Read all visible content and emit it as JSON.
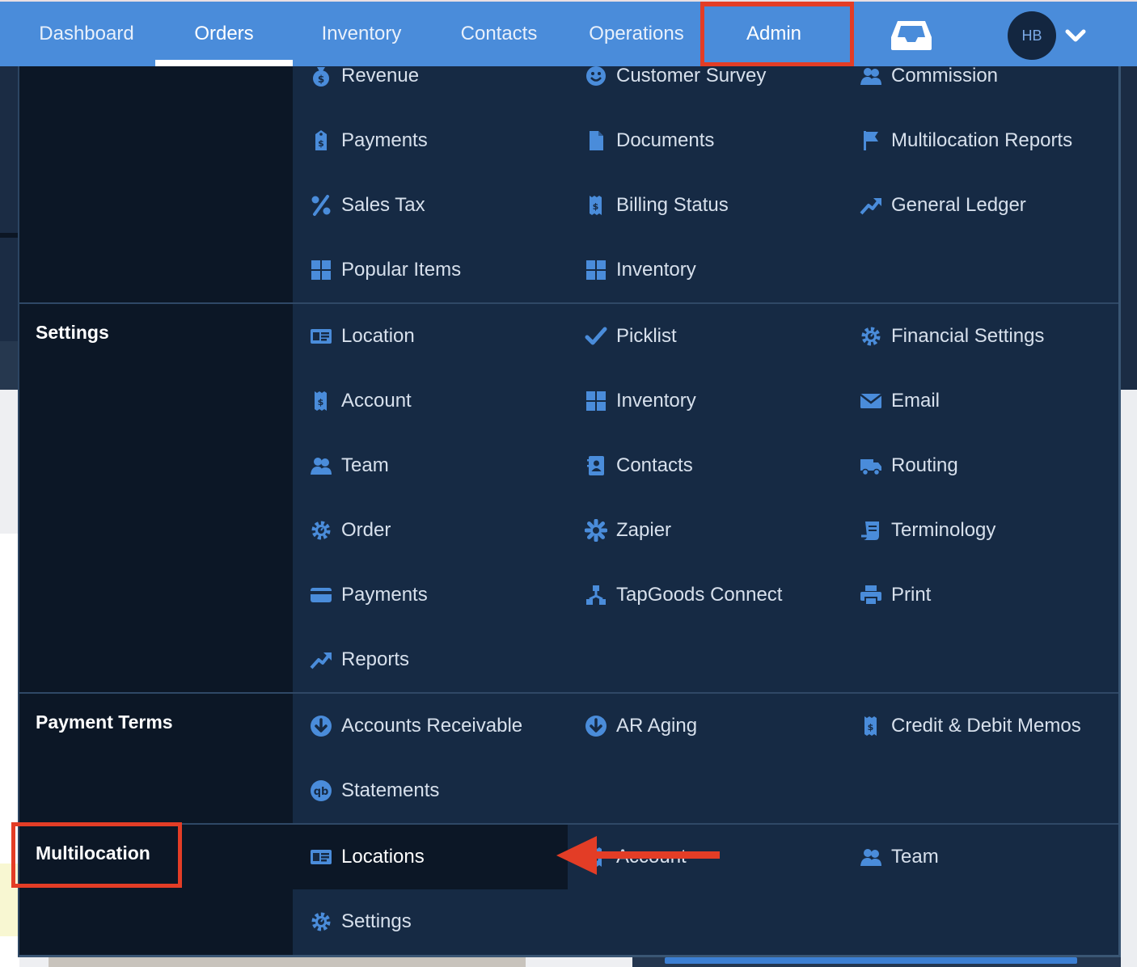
{
  "nav": {
    "items": [
      {
        "label": "Dashboard"
      },
      {
        "label": "Orders"
      },
      {
        "label": "Inventory"
      },
      {
        "label": "Contacts"
      },
      {
        "label": "Operations"
      },
      {
        "label": "Admin"
      }
    ],
    "active": "Orders",
    "annotated": "Admin",
    "inbox_icon": "inbox-icon",
    "avatar_initials": "HB",
    "dropdown_icon": "chevron-down-icon"
  },
  "menu": {
    "reports_items": [
      {
        "label": "Revenue",
        "icon": "money-bag-icon"
      },
      {
        "label": "Customer Survey",
        "icon": "smile-icon"
      },
      {
        "label": "Commission",
        "icon": "users-icon"
      },
      {
        "label": "Payments",
        "icon": "price-tag-icon"
      },
      {
        "label": "Documents",
        "icon": "file-icon"
      },
      {
        "label": "Multilocation Reports",
        "icon": "flag-icon"
      },
      {
        "label": "Sales Tax",
        "icon": "percent-icon"
      },
      {
        "label": "Billing Status",
        "icon": "receipt-icon"
      },
      {
        "label": "General Ledger",
        "icon": "trend-up-icon"
      },
      {
        "label": "Popular Items",
        "icon": "grid-icon"
      },
      {
        "label": "Inventory",
        "icon": "grid-icon"
      }
    ],
    "settings": {
      "title": "Settings",
      "items": [
        {
          "label": "Location",
          "icon": "id-card-icon"
        },
        {
          "label": "Picklist",
          "icon": "check-icon"
        },
        {
          "label": "Financial Settings",
          "icon": "gear-icon"
        },
        {
          "label": "Account",
          "icon": "receipt-icon"
        },
        {
          "label": "Inventory",
          "icon": "grid-icon"
        },
        {
          "label": "Email",
          "icon": "envelope-icon"
        },
        {
          "label": "Team",
          "icon": "users-icon"
        },
        {
          "label": "Contacts",
          "icon": "contact-book-icon"
        },
        {
          "label": "Routing",
          "icon": "truck-icon"
        },
        {
          "label": "Order",
          "icon": "gear-icon"
        },
        {
          "label": "Zapier",
          "icon": "asterisk-icon"
        },
        {
          "label": "Terminology",
          "icon": "scroll-icon"
        },
        {
          "label": "Payments",
          "icon": "credit-card-icon"
        },
        {
          "label": "TapGoods Connect",
          "icon": "network-icon"
        },
        {
          "label": "Print",
          "icon": "printer-icon"
        },
        {
          "label": "Reports",
          "icon": "trend-up-icon"
        }
      ]
    },
    "payment_terms": {
      "title": "Payment Terms",
      "items": [
        {
          "label": "Accounts Receivable",
          "icon": "arrow-circle-down-icon"
        },
        {
          "label": "AR Aging",
          "icon": "arrow-circle-down-icon"
        },
        {
          "label": "Credit & Debit Memos",
          "icon": "receipt-icon"
        },
        {
          "label": "Statements",
          "icon": "quickbooks-icon"
        }
      ]
    },
    "multilocation": {
      "title": "Multilocation",
      "items": [
        {
          "label": "Locations",
          "icon": "id-card-icon"
        },
        {
          "label": "Account",
          "icon": "receipt-icon"
        },
        {
          "label": "Team",
          "icon": "users-icon"
        },
        {
          "label": "Settings",
          "icon": "gear-icon"
        }
      ],
      "highlighted": "Locations"
    }
  },
  "colors": {
    "nav_bg": "#4a8cda",
    "menu_bg": "#162a44",
    "label_col_bg": "#0c1726",
    "icon": "#4a8cda",
    "annotation": "#e33d26"
  },
  "annotations": {
    "boxes": [
      "Admin",
      "Multilocation"
    ],
    "arrow_target": "Locations"
  }
}
